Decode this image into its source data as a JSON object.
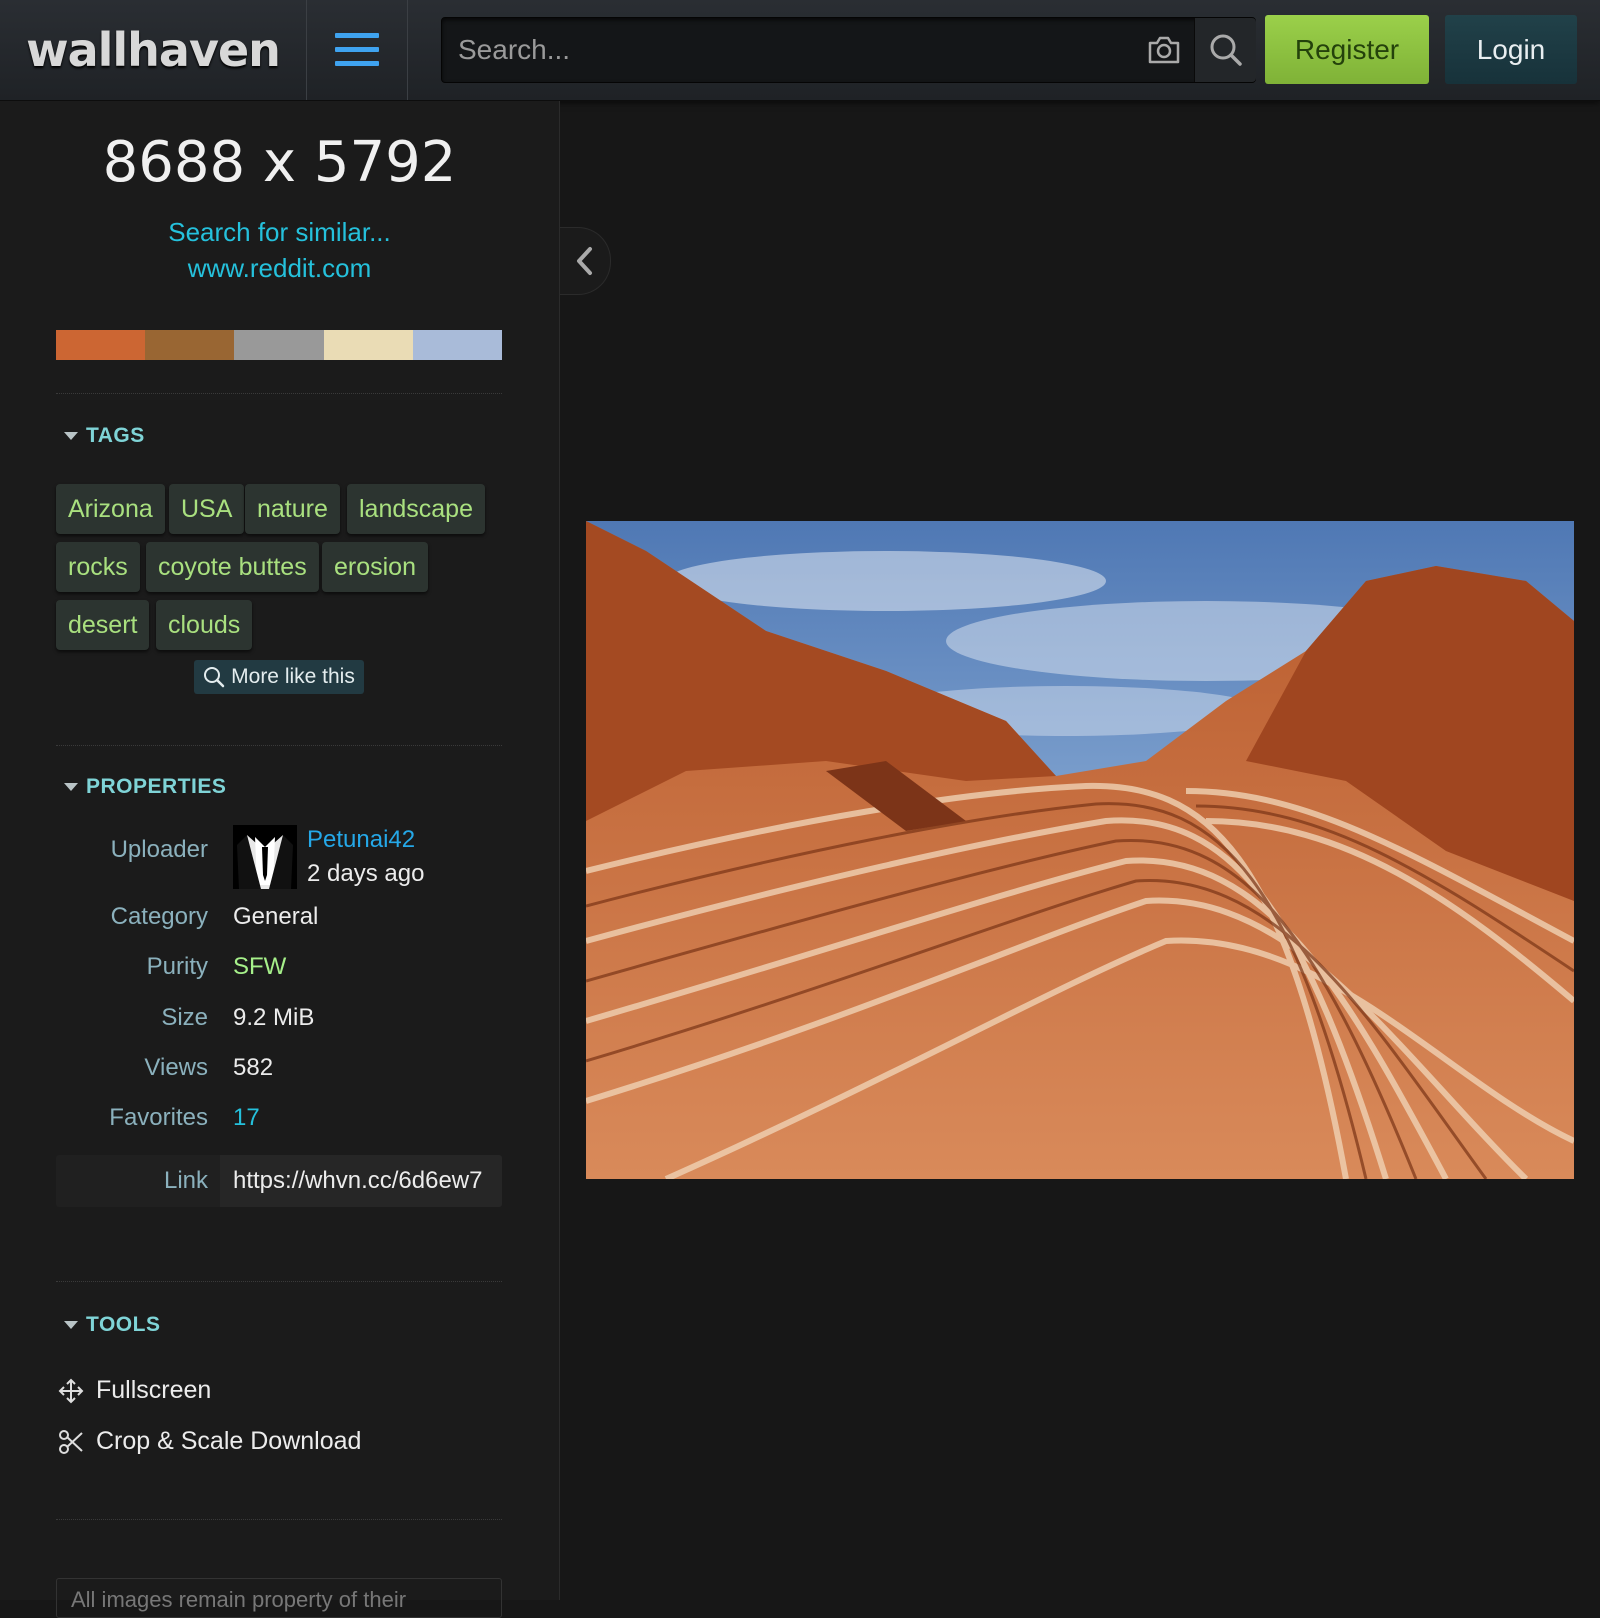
{
  "header": {
    "logo": "wallhaven",
    "search_placeholder": "Search...",
    "register_label": "Register",
    "login_label": "Login"
  },
  "sidebar": {
    "resolution": "8688 x 5792",
    "similar_link": "Search for similar...",
    "source_link": "www.reddit.com",
    "palette": [
      "#cc6633",
      "#996633",
      "#999999",
      "#eadcb5",
      "#a9bbd9"
    ],
    "tags_title": "TAGS",
    "tags": [
      "Arizona",
      "USA",
      "nature",
      "landscape",
      "rocks",
      "coyote buttes",
      "erosion",
      "desert",
      "clouds"
    ],
    "more_like_this": "More like this",
    "properties_title": "PROPERTIES",
    "properties": {
      "uploader_label": "Uploader",
      "uploader_name": "Petunai42",
      "uploaded_ago": "2 days ago",
      "category_label": "Category",
      "category_value": "General",
      "purity_label": "Purity",
      "purity_value": "SFW",
      "size_label": "Size",
      "size_value": "9.2 MiB",
      "views_label": "Views",
      "views_value": "582",
      "favorites_label": "Favorites",
      "favorites_value": "17",
      "link_label": "Link",
      "link_value": "https://whvn.cc/6d6ew7"
    },
    "tools_title": "TOOLS",
    "tools": [
      "Fullscreen",
      "Crop & Scale Download"
    ],
    "footer_text": "All images remain property of their"
  },
  "colors": {
    "accent": "#25c1dc",
    "tag_text": "#a9e07f",
    "section_title": "#7fd4d7",
    "register_bg": "#8dc141",
    "login_bg": "#1c3a42"
  }
}
